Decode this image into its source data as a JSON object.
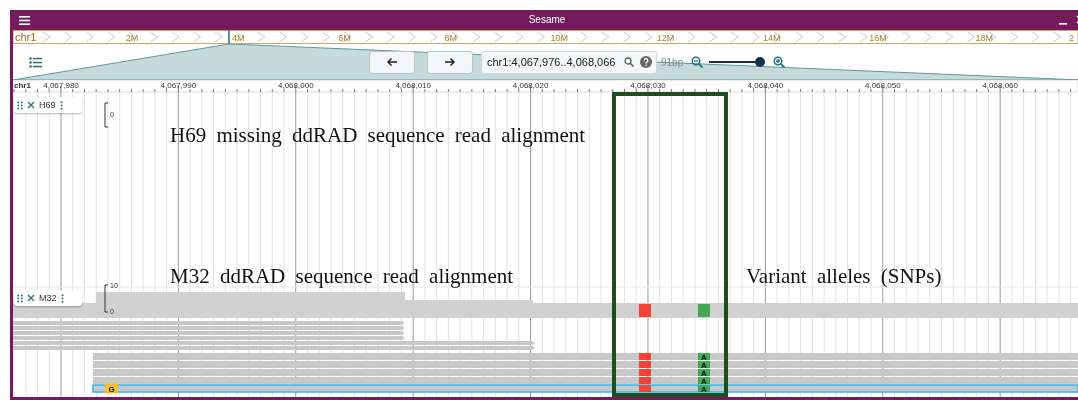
{
  "window": {
    "title": "Sesame"
  },
  "overview": {
    "chromosome": "chr1",
    "labels": [
      "2M",
      "4M",
      "6M",
      "8M",
      "10M",
      "12M",
      "14M",
      "16M",
      "18M",
      "2"
    ]
  },
  "toolbar": {
    "location": "chr1:4,067,976..4,068,066",
    "span": "91bp",
    "zoom": {
      "level": 0.98
    }
  },
  "ruler": {
    "chromosome": "chr1",
    "ticks": [
      "4,067,980",
      "4,067,990",
      "4,068,000",
      "4,068,010",
      "4,068,020",
      "4,068,030",
      "4,068,040",
      "4,068,050",
      "4,068,060"
    ]
  },
  "tracks": [
    {
      "name": "H69",
      "scale": [
        "0"
      ],
      "annotation": "H69 missing ddRAD sequence read alignment"
    },
    {
      "name": "M32",
      "scale": [
        "10",
        "0"
      ],
      "annotation": "M32 ddRAD sequence read alignment"
    }
  ],
  "variants": {
    "annotation": "Variant alleles (SNPs)",
    "items": [
      {
        "color": "#f44336"
      },
      {
        "color": "#43a854",
        "bases": [
          "A",
          "A",
          "A",
          "A",
          "A"
        ]
      }
    ]
  },
  "reads": [
    {
      "selected": false
    },
    {
      "selected": false
    },
    {
      "selected": false
    },
    {
      "selected": false
    },
    {
      "selected": false
    },
    {
      "selected": false
    },
    {
      "selected": false
    },
    {
      "selected": false
    },
    {
      "selected": false
    },
    {
      "selected": false
    },
    {
      "selected": true,
      "base": "G"
    }
  ]
}
